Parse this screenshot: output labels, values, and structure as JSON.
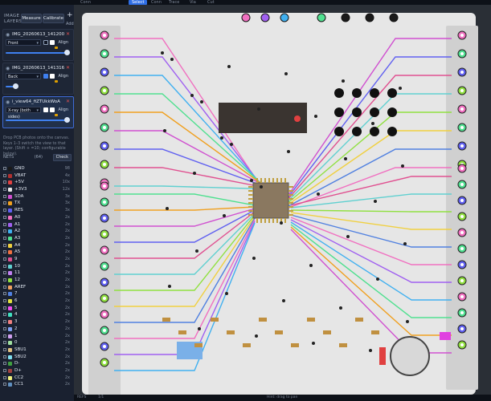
{
  "topbar": {
    "tabs": [
      "Select",
      "Conn",
      "Trace",
      "Via",
      "Cut"
    ],
    "active_tab": "Select"
  },
  "layers_panel": {
    "title": "IMAGE LAYERS",
    "measure_label": "Measure",
    "calibrate_label": "Calibrate",
    "add_label": "+",
    "add_sub": "Add",
    "layers": [
      {
        "name": "IMG_20260613_141200",
        "view": "Front",
        "align": "Align"
      },
      {
        "name": "IMG_20260613_141316",
        "view": "Back",
        "align": "Align"
      },
      {
        "name": "i_view64_fiZTUkkWoA",
        "view": "X-ray (both sides)",
        "align": "Align"
      }
    ],
    "hint": "Drop PCB photos onto the canvas. Keys 1–3 switch the view to that layer. (Shift + =10; configurable below)."
  },
  "nets_panel": {
    "title": "NETS",
    "count": "(64)",
    "check_label": "Check",
    "nets": [
      {
        "name": "GND",
        "count": "98",
        "color": "#1a1a1a"
      },
      {
        "name": "VBAT",
        "count": "4x",
        "color": "#b03030"
      },
      {
        "name": "+5V",
        "count": "10x",
        "color": "#e04040"
      },
      {
        "name": "+3V3",
        "count": "12x",
        "color": "#e8e8e8"
      },
      {
        "name": "SDA",
        "count": "3x",
        "color": "#d050d0"
      },
      {
        "name": "TX",
        "count": "3x",
        "color": "#f0a020"
      },
      {
        "name": "RES",
        "count": "3x",
        "color": "#6060f0"
      },
      {
        "name": "A0",
        "count": "2x",
        "color": "#f070c0"
      },
      {
        "name": "A1",
        "count": "2x",
        "color": "#a060f0"
      },
      {
        "name": "A2",
        "count": "2x",
        "color": "#40b0f0"
      },
      {
        "name": "A3",
        "count": "2x",
        "color": "#50e090"
      },
      {
        "name": "A4",
        "count": "2x",
        "color": "#f0d040"
      },
      {
        "name": "A5",
        "count": "2x",
        "color": "#f07040"
      },
      {
        "name": "9",
        "count": "2x",
        "color": "#e05090"
      },
      {
        "name": "10",
        "count": "2x",
        "color": "#60d0d0"
      },
      {
        "name": "11",
        "count": "2x",
        "color": "#c080f0"
      },
      {
        "name": "12",
        "count": "2x",
        "color": "#90e040"
      },
      {
        "name": "AREF",
        "count": "2x",
        "color": "#f0a060"
      },
      {
        "name": "7",
        "count": "2x",
        "color": "#5080e0"
      },
      {
        "name": "6",
        "count": "2x",
        "color": "#e0e040"
      },
      {
        "name": "5",
        "count": "2x",
        "color": "#f050f0"
      },
      {
        "name": "4",
        "count": "2x",
        "color": "#40e0c0"
      },
      {
        "name": "3",
        "count": "2x",
        "color": "#f08080"
      },
      {
        "name": "2",
        "count": "2x",
        "color": "#80a0f0"
      },
      {
        "name": "1",
        "count": "2x",
        "color": "#d0a0f0"
      },
      {
        "name": "0",
        "count": "2x",
        "color": "#a0e0a0"
      },
      {
        "name": "SBU1",
        "count": "2x",
        "color": "#e0c080"
      },
      {
        "name": "SBU2",
        "count": "2x",
        "color": "#80e0f0"
      },
      {
        "name": "D-",
        "count": "2x",
        "color": "#40a040"
      },
      {
        "name": "D+",
        "count": "2x",
        "color": "#a04040"
      },
      {
        "name": "CC2",
        "count": "2x",
        "color": "#f0f080"
      },
      {
        "name": "CC1",
        "count": "2x",
        "color": "#6090c0"
      }
    ]
  },
  "canvas": {
    "board_color": "#e4e4e4",
    "headers": [
      {
        "side": "left",
        "count": 9
      },
      {
        "side": "left",
        "count": 12
      },
      {
        "side": "right",
        "count": 8
      },
      {
        "side": "right",
        "count": 11
      }
    ]
  },
  "status_bar": {
    "text1": "REFS",
    "text2": "1/1",
    "text3": "Hint: drag to pan"
  }
}
